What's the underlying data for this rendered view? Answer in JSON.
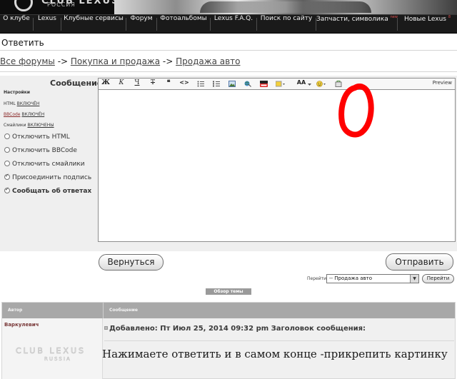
{
  "header": {
    "brand": "CLUB LEXUS",
    "region": "РОССИЯ"
  },
  "nav": {
    "items": [
      {
        "label": "О клубе",
        "badge": ""
      },
      {
        "label": "Lexus",
        "badge": ""
      },
      {
        "label": "Клубные сервисы",
        "badge": ""
      },
      {
        "label": "Форум",
        "badge": ""
      },
      {
        "label": "Фотоальбомы",
        "badge": ""
      },
      {
        "label": "Lexus F.A.Q.",
        "badge": ""
      },
      {
        "label": "Поиск по сайту",
        "badge": ""
      },
      {
        "label": "Запчасти, символика",
        "badge": "new"
      },
      {
        "label": "Новые Lexus",
        "badge": "8"
      }
    ]
  },
  "page": {
    "title": "Ответить"
  },
  "breadcrumb": {
    "items": [
      "Все форумы",
      "Покупка и продажа",
      "Продажа авто"
    ],
    "separator": " -> "
  },
  "editor": {
    "message_label": "Сообщение:",
    "settings_title": "Настройки",
    "settings": [
      {
        "name": "HTML",
        "state": "ВКЛЮЧЁН"
      },
      {
        "name": "BBCode",
        "state": "ВКЛЮЧЁН"
      },
      {
        "name": "Смайлики",
        "state": "ВКЛЮЧЕНЫ"
      }
    ],
    "options": [
      {
        "label": "Отключить HTML",
        "checked": false
      },
      {
        "label": "Отключить BBCode",
        "checked": false
      },
      {
        "label": "Отключить смайлики",
        "checked": false
      },
      {
        "label": "Присоединить подпись",
        "checked": true
      },
      {
        "label": "Сообщать об ответах",
        "checked": true
      }
    ],
    "toolbar": {
      "bold": "Ж",
      "italic": "К",
      "underline": "Ч",
      "strike": "Т",
      "quote": "❝",
      "code": "<>",
      "font_size": "AA",
      "preview": "Preview"
    },
    "body": ""
  },
  "actions": {
    "back_label": "Вернуться",
    "send_label": "Отправить"
  },
  "jump": {
    "label": "Перейти:",
    "selected": "-- Продажа авто",
    "go_label": "Перейти"
  },
  "review": {
    "title": "Обзор темы",
    "col_author": "Автор",
    "col_message": "Сообщение",
    "post": {
      "author": "Варкулевич",
      "meta": "Добавлено: Пт Июл 25, 2014 09:32 pm      Заголовок сообщения:",
      "body": "Нажимаете ответить и в самом конце -прикрепить картинку"
    }
  },
  "colors": {
    "nav_bg": "#1a1a1a",
    "annotation": "#ff0000",
    "author_name": "#7a3a3a"
  }
}
